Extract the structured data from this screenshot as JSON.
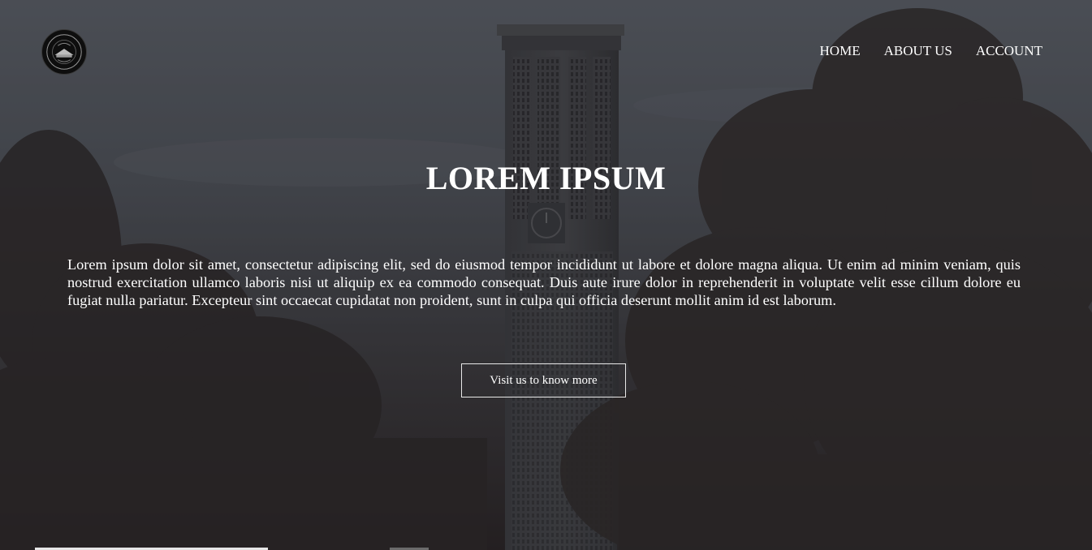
{
  "nav": {
    "items": [
      "HOME",
      "ABOUT US",
      "ACCOUNT"
    ]
  },
  "hero": {
    "title": "LOREM IPSUM",
    "body": "Lorem ipsum dolor sit amet, consectetur adipiscing elit, sed do eiusmod tempor incididunt ut labore et dolore magna aliqua. Ut enim ad minim veniam, quis nostrud exercitation ullamco laboris nisi ut aliquip ex ea commodo consequat. Duis aute irure dolor in reprehenderit in voluptate velit esse cillum dolore eu fugiat nulla pariatur. Excepteur sint occaecat cupidatat non proident, sunt in culpa qui officia deserunt mollit anim id est laborum.",
    "cta_label": "Visit us to know more"
  },
  "logo": {
    "icon": "university-seal-icon"
  },
  "colors": {
    "text": "#ffffff",
    "sky_top": "#5d636b",
    "ground": "#2b2627",
    "button_border": "#e8e8e8"
  }
}
